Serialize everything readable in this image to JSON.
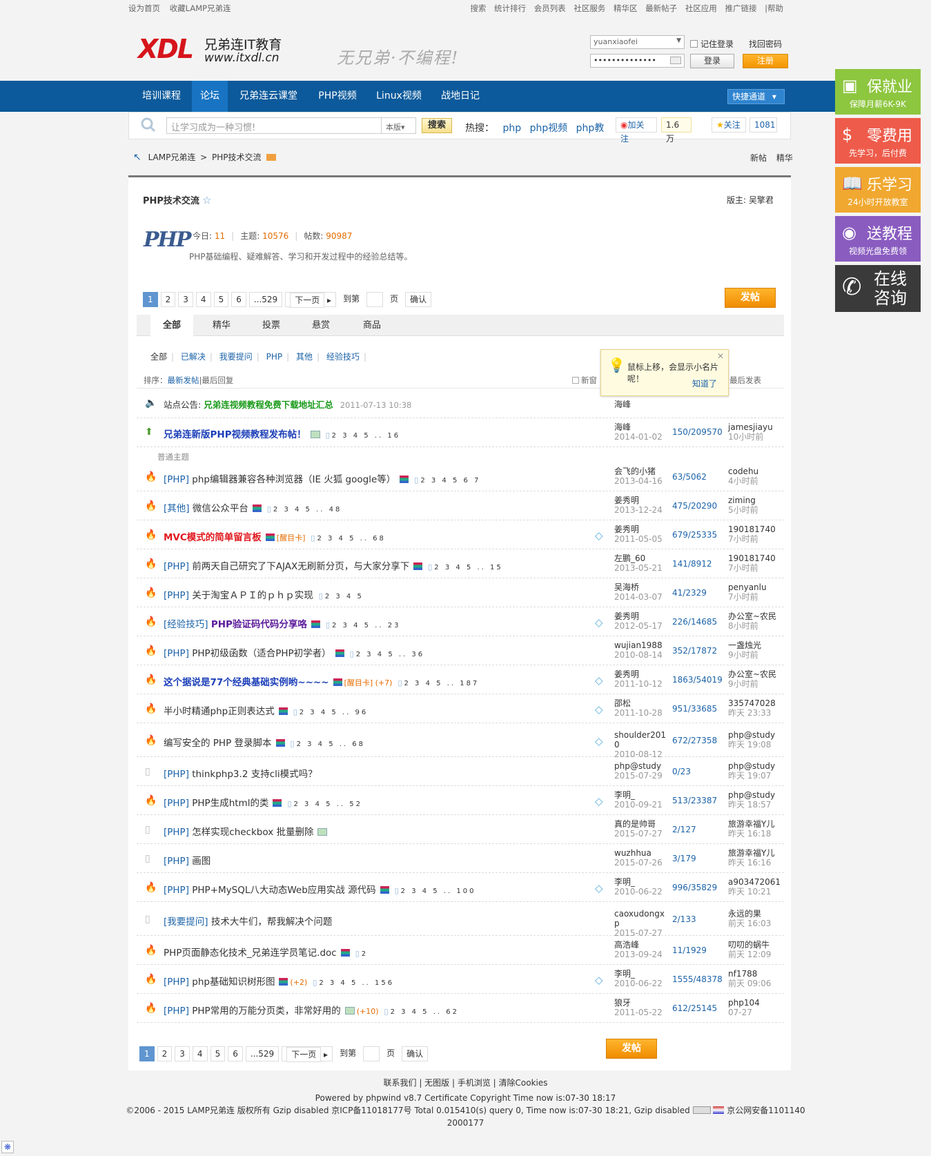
{
  "topbar": {
    "left": [
      "设为首页",
      "收藏LAMP兄弟连"
    ],
    "right": [
      "搜索",
      "统计排行",
      "会员列表",
      "社区服务",
      "精华区",
      "最新帖子",
      "社区应用",
      "推广链接",
      "|帮助"
    ]
  },
  "logo": {
    "mark": "XDL",
    "name": "兄弟连IT教育",
    "url": "www.itxdl.cn"
  },
  "slogan": "无兄弟·不编程!",
  "login": {
    "username": "yuanxiaofei",
    "password": "••••••••••••••",
    "remember": "记住登录",
    "forgot": "找回密码",
    "login_btn": "登录",
    "register_btn": "注册"
  },
  "nav": {
    "items": [
      "培训课程",
      "论坛",
      "兄弟连云课堂",
      "PHP视频",
      "Linux视频",
      "战地日记"
    ],
    "quick": "快捷通道"
  },
  "search": {
    "placeholder": "让学习成为一种习惯!",
    "scope": "本版",
    "button": "搜索",
    "hot_label": "热搜：",
    "hot": [
      "php",
      "php视频",
      "php教"
    ],
    "weibo_follow": "加关注",
    "weibo_count": "1.6万",
    "star_follow": "关注",
    "star_count": "1081"
  },
  "breadcrumb": {
    "items": [
      "LAMP兄弟连",
      "PHP技术交流"
    ],
    "right": [
      "新帖",
      "精华"
    ]
  },
  "forum": {
    "title": "PHP技术交流",
    "moderator_label": "版主:",
    "moderator": "吴擎君",
    "logo_text": "PHP",
    "today_label": "今日:",
    "today": "11",
    "topics_label": "主题:",
    "topics": "10576",
    "posts_label": "帖数:",
    "posts": "90987",
    "description": "PHP基础编程、疑难解答、学习和开发过程中的经验总结等。"
  },
  "pager": {
    "pages": [
      "1",
      "2",
      "3",
      "4",
      "5",
      "6",
      "...529"
    ],
    "next": "下一页",
    "goto": "到第",
    "page_unit": "页",
    "confirm": "确认"
  },
  "post_btn": "发帖",
  "tabs": [
    "全部",
    "精华",
    "投票",
    "悬赏",
    "商品"
  ],
  "subtabs": [
    "全部",
    "已解决",
    "我要提问",
    "PHP",
    "其他",
    "经验技巧"
  ],
  "sort": {
    "label": "排序：",
    "latest": "最新发帖",
    "last_reply": "|最后回复",
    "new_window": "新窗",
    "last_post": "最后发表"
  },
  "tip": {
    "text": "鼠标上移，会显示小名片呢！",
    "ok": "知道了"
  },
  "announcement": {
    "label": "站点公告:",
    "title": "兄弟连视频教程免费下载地址汇总",
    "time": "2011-07-13 10:38",
    "author": "海峰"
  },
  "sticky": {
    "title": "兄弟连新版PHP视频教程发布帖！",
    "pages": "2 3 4 5 .. 16",
    "author": "海峰",
    "date": "2014-01-02",
    "rv": "150/209570",
    "lp_user": "jamesjiayu",
    "lp_time": "10小时前"
  },
  "normal_label": "普通主题",
  "threads": [
    {
      "cat": "[PHP]",
      "title": "php编辑器兼容各种浏览器（IE 火狐 google等）",
      "pages": "2 3 4 5 6 7",
      "author": "会飞的小猪",
      "date": "2013-04-16",
      "rv": "63/5062",
      "lp_user": "codehu",
      "lp_time": "4小时前"
    },
    {
      "cat": "[其他]",
      "title": "微信公众平台",
      "pages": "2 3 4 5 .. 48",
      "author": "姜秀明",
      "date": "2013-12-24",
      "rv": "475/20290",
      "lp_user": "ziming",
      "lp_time": "5小时前"
    },
    {
      "cat": "",
      "title": "MVC模式的简单留言板",
      "extra": "[醒目卡]",
      "pages": "2 3 4 5 .. 68",
      "author": "姜秀明",
      "date": "2011-05-05",
      "rv": "679/25335",
      "lp_user": "190181740",
      "lp_time": "7小时前"
    },
    {
      "cat": "[PHP]",
      "title": "前两天自己研究了下AJAX无刷新分页，与大家分享下",
      "pages": "2 3 4 5 .. 15",
      "author": "左鹏_60",
      "date": "2013-05-21",
      "rv": "141/8912",
      "lp_user": "190181740",
      "lp_time": "7小时前"
    },
    {
      "cat": "[PHP]",
      "title": "关于淘宝ＡＰＩ的ｐｈｐ实现",
      "pages": "2 3 4 5",
      "author": "吴海桥",
      "date": "2014-03-07",
      "rv": "41/2329",
      "lp_user": "penyanlu",
      "lp_time": "7小时前"
    },
    {
      "cat": "[经验技巧]",
      "title": "PHP验证码代码分享咯",
      "pages": "2 3 4 5 .. 23",
      "author": "姜秀明",
      "date": "2012-05-17",
      "rv": "226/14685",
      "lp_user": "办公室~农民",
      "lp_time": "8小时前"
    },
    {
      "cat": "[PHP]",
      "title": "PHP初级函数（适合PHP初学者）",
      "pages": "2 3 4 5 .. 36",
      "author": "wujian1988",
      "date": "2010-08-14",
      "rv": "352/17872",
      "lp_user": "一盏烛光",
      "lp_time": "9小时前"
    },
    {
      "cat": "",
      "title": "这个据说是77个经典基础实例哟~~~~",
      "extra": "[醒目卡] (+7)",
      "pages": "2 3 4 5 .. 187",
      "author": "姜秀明",
      "date": "2011-10-12",
      "rv": "1863/54019",
      "lp_user": "办公室~农民",
      "lp_time": "9小时前"
    },
    {
      "cat": "",
      "title": "半小时精通php正则表达式",
      "pages": "2 3 4 5 .. 96",
      "author": "邵松",
      "date": "2011-10-28",
      "rv": "951/33685",
      "lp_user": "335747028",
      "lp_time": "昨天 23:33"
    },
    {
      "cat": "",
      "title": "编写安全的 PHP 登录脚本",
      "pages": "2 3 4 5 .. 68",
      "author": "shoulder2010",
      "date": "2010-08-12",
      "rv": "672/27358",
      "lp_user": "php@study",
      "lp_time": "昨天 19:08"
    },
    {
      "cat": "[PHP]",
      "title": "thinkphp3.2 支持cli模式吗？",
      "pages": "",
      "author": "php@study",
      "date": "2015-07-29",
      "rv": "0/23",
      "lp_user": "php@study",
      "lp_time": "昨天 19:07"
    },
    {
      "cat": "[PHP]",
      "title": "PHP生成html的类",
      "pages": "2 3 4 5 .. 52",
      "author": "李明_",
      "date": "2010-09-21",
      "rv": "513/23387",
      "lp_user": "php@study",
      "lp_time": "昨天 18:57"
    },
    {
      "cat": "[PHP]",
      "title": "怎样实现checkbox 批量删除",
      "pages": "",
      "author": "真的是帅哥",
      "date": "2015-07-27",
      "rv": "2/127",
      "lp_user": "旅游幸福Y儿",
      "lp_time": "昨天 16:18"
    },
    {
      "cat": "[PHP]",
      "title": "画图",
      "pages": "",
      "author": "wuzhhua",
      "date": "2015-07-26",
      "rv": "3/179",
      "lp_user": "旅游幸福Y儿",
      "lp_time": "昨天 16:16"
    },
    {
      "cat": "[PHP]",
      "title": "PHP+MySQL八大动态Web应用实战 源代码",
      "pages": "2 3 4 5 .. 100",
      "author": "李明_",
      "date": "2010-06-22",
      "rv": "996/35829",
      "lp_user": "a903472061",
      "lp_time": "昨天 10:21"
    },
    {
      "cat": "[我要提问]",
      "title": "技术大牛们，帮我解决个问题",
      "pages": "",
      "author": "caoxudongxp",
      "date": "2015-07-27",
      "rv": "2/133",
      "lp_user": "永远的果",
      "lp_time": "前天 16:03"
    },
    {
      "cat": "",
      "title": "PHP页面静态化技术_兄弟连学员笔记.doc",
      "pages": "2",
      "author": "高浩峰",
      "date": "2013-09-24",
      "rv": "11/1929",
      "lp_user": "叨叨的蜗牛",
      "lp_time": "前天 12:09"
    },
    {
      "cat": "[PHP]",
      "title": "php基础知识树形图",
      "extra": "(+2)",
      "pages": "2 3 4 5 .. 156",
      "author": "李明_",
      "date": "2010-06-22",
      "rv": "1555/48378",
      "lp_user": "nf1788",
      "lp_time": "前天 09:06"
    },
    {
      "cat": "[PHP]",
      "title": "PHP常用的万能分页类，非常好用的",
      "extra": "(+10)",
      "pages": "2 3 4 5 .. 62",
      "author": "狼牙",
      "date": "2011-05-22",
      "rv": "612/25145",
      "lp_user": "php104",
      "lp_time": "07-27"
    }
  ],
  "sidebar": [
    {
      "title": "保就业",
      "sub": "保障月薪6K-9K",
      "color": "#8dc63f"
    },
    {
      "title": "零费用",
      "sub": "先学习，后付费",
      "color": "#ee5b4a"
    },
    {
      "title": "乐学习",
      "sub": "24小时开放教室",
      "color": "#f0a830"
    },
    {
      "title": "送教程",
      "sub": "视频光盘免费领",
      "color": "#8a5cc0"
    },
    {
      "title": "在线咨询",
      "sub": "",
      "color": "#3a3a3a"
    }
  ],
  "footer": {
    "links": "联系我们 | 无图版 | 手机浏览 | 清除Cookies",
    "powered": "Powered by phpwind v8.7 Certificate Copyright Time now is:07-30 18:17",
    "copyright": "©2006 - 2015 LAMP兄弟连 版权所有 Gzip disabled 京ICP备11018177号 Total 0.015410(s) query 0, Time now is:07-30 18:21, Gzip disabled",
    "police": "京公网安备1101140",
    "police2": "2000177"
  }
}
